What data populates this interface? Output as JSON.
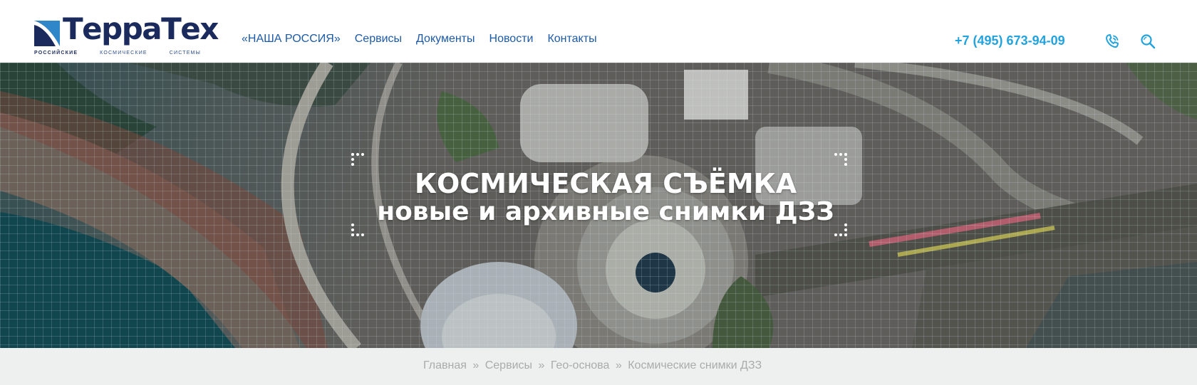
{
  "brand": {
    "name": "ТерраТех",
    "tagline": [
      "РОССИЙСКИЕ",
      "КОСМИЧЕСКИЕ",
      "СИСТЕМЫ"
    ],
    "color": "#1b2a5c"
  },
  "nav": {
    "items": [
      "«НАША РОССИЯ»",
      "Сервисы",
      "Документы",
      "Новости",
      "Контакты"
    ],
    "color": "#1d5aa6"
  },
  "contact": {
    "phone": "+7 (495) 673-94-09",
    "phone_color": "#22a3de",
    "icons": [
      "phone-icon",
      "search-icon"
    ]
  },
  "hero": {
    "title": "КОСМИЧЕСКАЯ СЪЁМКА",
    "subtitle": "новые и архивные снимки ДЗЗ"
  },
  "breadcrumb": {
    "items": [
      "Главная",
      "Сервисы",
      "Гео-основа",
      "Космические снимки ДЗЗ"
    ],
    "separator": "»"
  }
}
